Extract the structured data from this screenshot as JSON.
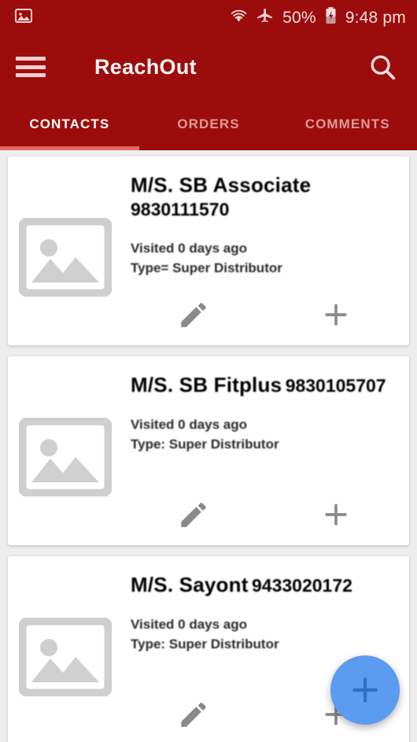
{
  "statusbar": {
    "left_icon": "image-icon",
    "wifi_icon": "wifi-icon",
    "airplane_icon": "airplane-mode-icon",
    "battery_percent": "50%",
    "battery_icon": "battery-charging-icon",
    "time": "9:48 pm"
  },
  "appbar": {
    "menu_icon": "hamburger-menu-icon",
    "title": "ReachOut",
    "search_icon": "search-icon"
  },
  "tabs": [
    {
      "label": "CONTACTS",
      "active": true
    },
    {
      "label": "ORDERS",
      "active": false
    },
    {
      "label": "COMMENTS",
      "active": false
    }
  ],
  "colors": {
    "app_bar": "#9d0c0c",
    "tab_indicator": "#e46a6a",
    "page_background": "#ededed",
    "card_background": "#ffffff",
    "fab": "#5b9bf0",
    "fab_icon": "#2f6fc4",
    "placeholder_icon": "#cfcfcf",
    "action_icon": "#8a8a8a"
  },
  "contacts": [
    {
      "thumb_icon": "image-placeholder-icon",
      "name": "M/S. SB Associate",
      "phone": "9830111570",
      "visited": "Visited 0 days ago",
      "type": "Type= Super Distributor",
      "edit_icon": "pencil-edit-icon",
      "add_icon": "plus-icon"
    },
    {
      "thumb_icon": "image-placeholder-icon",
      "name": "M/S. SB Fitplus",
      "phone": "9830105707",
      "visited": "Visited 0 days ago",
      "type": "Type: Super Distributor",
      "edit_icon": "pencil-edit-icon",
      "add_icon": "plus-icon"
    },
    {
      "thumb_icon": "image-placeholder-icon",
      "name": "M/S. Sayont",
      "phone": "9433020172",
      "visited": "Visited 0 days ago",
      "type": "Type: Super Distributor",
      "edit_icon": "pencil-edit-icon",
      "add_icon": "plus-icon"
    }
  ],
  "fab": {
    "icon": "plus-icon",
    "label": "+"
  }
}
